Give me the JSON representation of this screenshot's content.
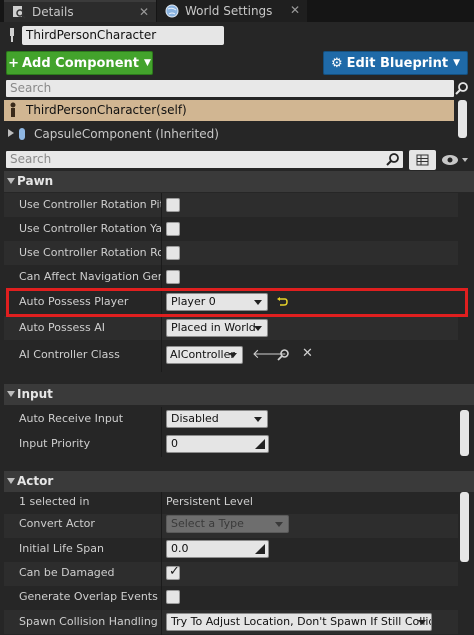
{
  "tabs": [
    {
      "label": "Details",
      "icon": "magnifier-doc-icon",
      "active": true
    },
    {
      "label": "World Settings",
      "icon": "globe-icon",
      "active": false
    }
  ],
  "object_name": "ThirdPersonCharacter",
  "toolbar": {
    "add_component": "Add Component",
    "edit_blueprint": "Edit Blueprint"
  },
  "components_search_placeholder": "Search",
  "components": {
    "selected": "ThirdPersonCharacter(self)",
    "child": "CapsuleComponent (Inherited)"
  },
  "details_search_placeholder": "Search",
  "pawn": {
    "title": "Pawn",
    "props": {
      "pitch_label": "Use Controller Rotation Pitch",
      "yaw_label": "Use Controller Rotation Yaw",
      "roll_label": "Use Controller Rotation Roll",
      "nav_label": "Can Affect Navigation Generation",
      "auto_possess_player_label": "Auto Possess Player",
      "auto_possess_player_value": "Player 0",
      "auto_possess_ai_label": "Auto Possess AI",
      "auto_possess_ai_value": "Placed in World",
      "ai_controller_label": "AI Controller Class",
      "ai_controller_value": "AIController"
    }
  },
  "input": {
    "title": "Input",
    "props": {
      "auto_receive_label": "Auto Receive Input",
      "auto_receive_value": "Disabled",
      "priority_label": "Input Priority",
      "priority_value": "0"
    }
  },
  "actor": {
    "title": "Actor",
    "props": {
      "selected_label": "1 selected in",
      "selected_value": "Persistent Level",
      "convert_label": "Convert Actor",
      "convert_value": "Select a Type",
      "lifespan_label": "Initial Life Span",
      "lifespan_value": "0.0",
      "damaged_label": "Can be Damaged",
      "overlap_label": "Generate Overlap Events During Level Streaming",
      "spawn_label": "Spawn Collision Handling Method",
      "spawn_value": "Try To Adjust Location, Don't Spawn If Still Colliding"
    }
  },
  "colors": {
    "add_button": "#43a32c",
    "edit_button": "#1f6aa8",
    "selected_component": "#d1b692",
    "highlight": "#e01f1f"
  }
}
